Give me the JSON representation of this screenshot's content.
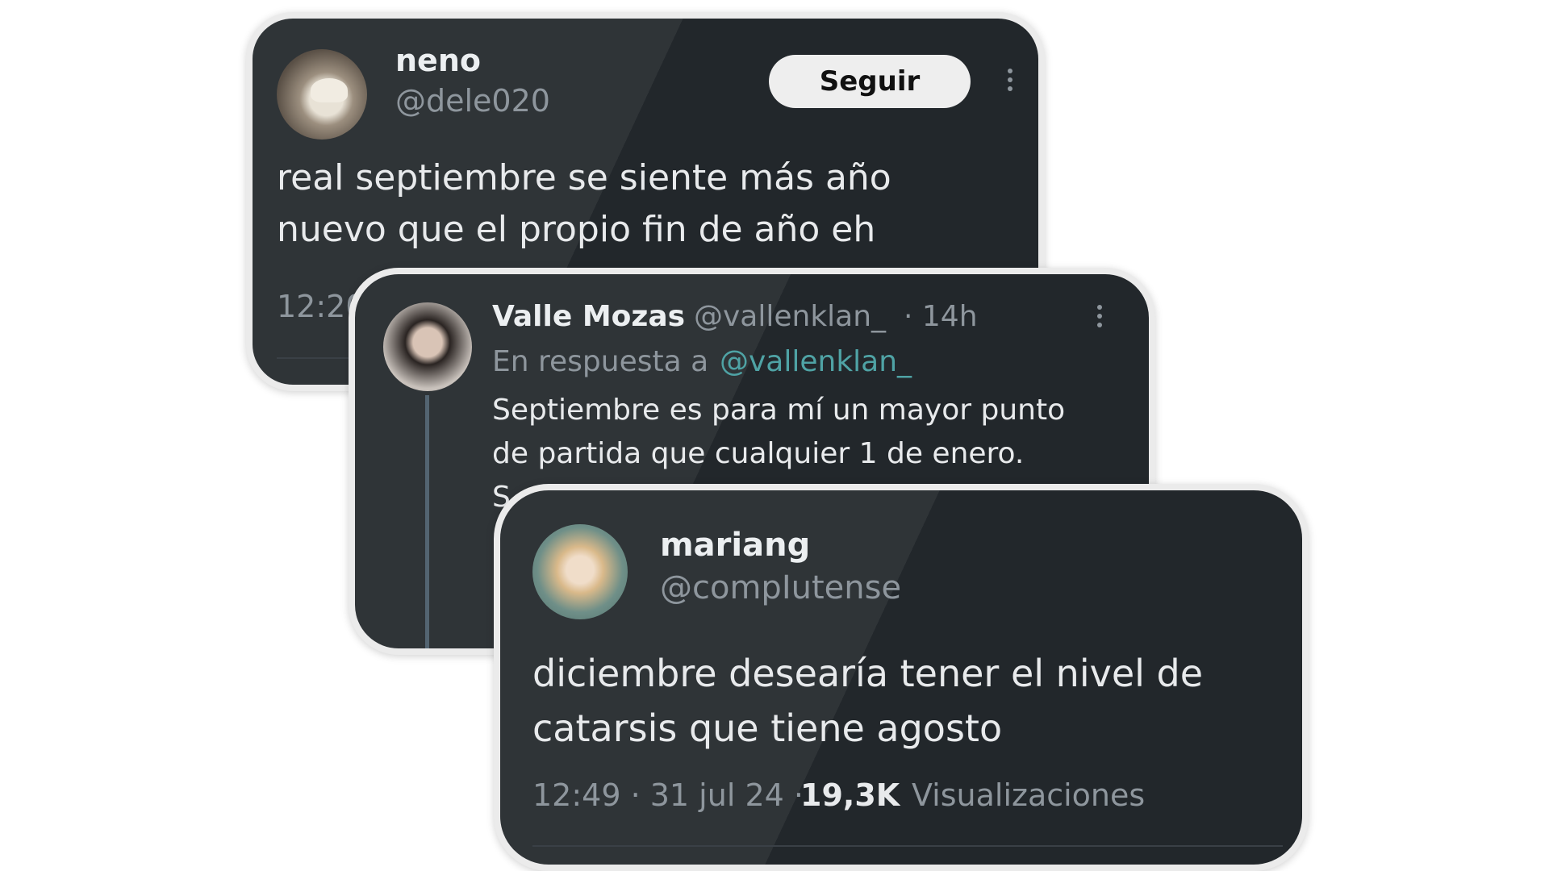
{
  "tweet1": {
    "name": "neno",
    "handle": "@dele020",
    "follow_label": "Seguir",
    "text_line1": "real septiembre se siente más año",
    "text_line2": "nuevo que el propio fin de año eh",
    "time_partial": "12:20",
    "more_icon": "more-vertical-icon"
  },
  "tweet2": {
    "name": "Valle Mozas",
    "handle": "@vallenklan_",
    "age": "· 14h",
    "reply_prefix": "En respuesta a",
    "reply_handle": "@vallenklan_",
    "text_line1": "Septiembre es para mí un mayor punto",
    "text_line2": "de partida que cualquier 1 de enero.",
    "text_line3_partial": "S",
    "more_icon": "more-vertical-icon"
  },
  "tweet3": {
    "name": "mariang",
    "handle": "@compIutense",
    "text_line1": "diciembre desearía tener el nivel de",
    "text_line2": "catarsis que tiene agosto",
    "time": "12:49 · 31 jul 24 ·",
    "views_count": "19,3K",
    "views_label": "Visualizaciones"
  },
  "colors": {
    "card_bg": "#22272b",
    "link": "#4fa3a5",
    "follow_bg": "#eeeeee"
  }
}
